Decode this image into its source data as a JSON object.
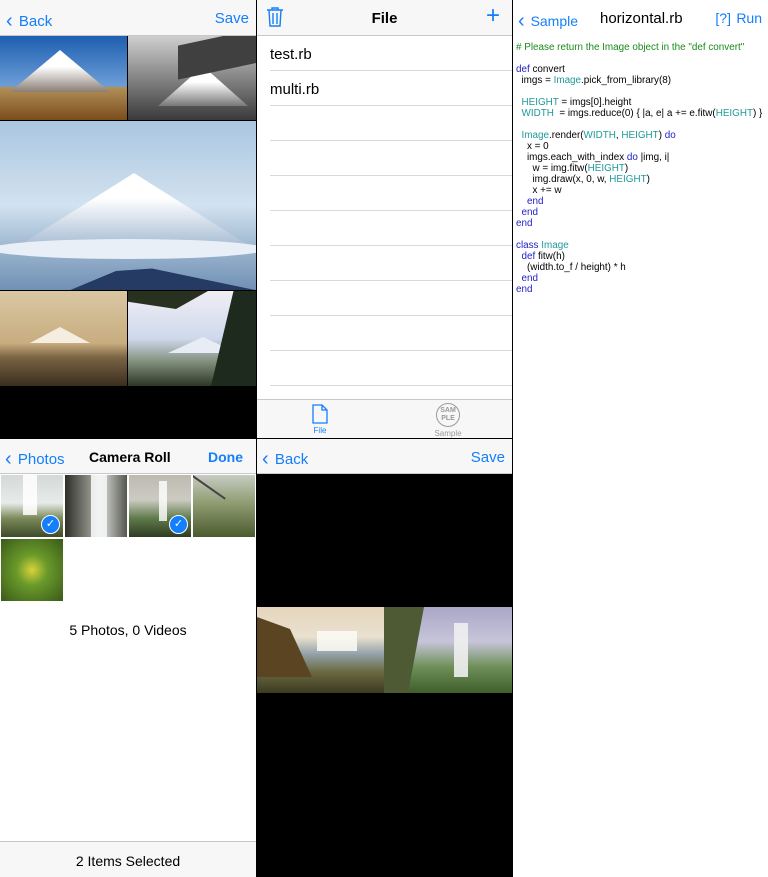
{
  "panel1": {
    "back_label": "Back",
    "save_label": "Save"
  },
  "panel2": {
    "title": "File",
    "files": [
      "test.rb",
      "multi.rb"
    ],
    "tabs": [
      {
        "label": "File",
        "icon": "file-icon"
      },
      {
        "label": "Sample",
        "icon": "sample-icon",
        "badge": "SAM\nPLE"
      }
    ]
  },
  "panel3": {
    "back_label": "Sample",
    "title": "horizontal.rb",
    "help_label": "[?]",
    "run_label": "Run",
    "code": [
      [
        [
          "# Please return the Image object in the \"def convert\"",
          "com"
        ]
      ],
      [
        [
          "",
          "txt"
        ]
      ],
      [
        [
          "def",
          "kw"
        ],
        [
          " convert",
          "txt"
        ]
      ],
      [
        [
          "  imgs = ",
          "txt"
        ],
        [
          "Image",
          "cl"
        ],
        [
          ".pick_from_library(8)",
          "txt"
        ]
      ],
      [
        [
          "",
          "txt"
        ]
      ],
      [
        [
          "  ",
          "txt"
        ],
        [
          "HEIGHT",
          "cl"
        ],
        [
          " = imgs[0].height",
          "txt"
        ]
      ],
      [
        [
          "  ",
          "txt"
        ],
        [
          "WIDTH",
          "cl"
        ],
        [
          "  = imgs.reduce(0) { |a, e| a += e.fitw(",
          "txt"
        ],
        [
          "HEIGHT",
          "cl"
        ],
        [
          ") }",
          "txt"
        ]
      ],
      [
        [
          "",
          "txt"
        ]
      ],
      [
        [
          "  ",
          "txt"
        ],
        [
          "Image",
          "cl"
        ],
        [
          ".render(",
          "txt"
        ],
        [
          "WIDTH",
          "cl"
        ],
        [
          ", ",
          "txt"
        ],
        [
          "HEIGHT",
          "cl"
        ],
        [
          ") ",
          "txt"
        ],
        [
          "do",
          "kw"
        ]
      ],
      [
        [
          "    x = 0",
          "txt"
        ]
      ],
      [
        [
          "    imgs.each_with_index ",
          "txt"
        ],
        [
          "do",
          "kw"
        ],
        [
          " |img, i|",
          "txt"
        ]
      ],
      [
        [
          "      w = img.fitw(",
          "txt"
        ],
        [
          "HEIGHT",
          "cl"
        ],
        [
          ")",
          "txt"
        ]
      ],
      [
        [
          "      img.draw(x, 0, w, ",
          "txt"
        ],
        [
          "HEIGHT",
          "cl"
        ],
        [
          ")",
          "txt"
        ]
      ],
      [
        [
          "      x += w",
          "txt"
        ]
      ],
      [
        [
          "    ",
          "txt"
        ],
        [
          "end",
          "kw"
        ]
      ],
      [
        [
          "  ",
          "txt"
        ],
        [
          "end",
          "kw"
        ]
      ],
      [
        [
          "end",
          "kw"
        ]
      ],
      [
        [
          "",
          "txt"
        ]
      ],
      [
        [
          "class",
          "kw"
        ],
        [
          " ",
          "txt"
        ],
        [
          "Image",
          "cl"
        ]
      ],
      [
        [
          "  ",
          "txt"
        ],
        [
          "def",
          "kw"
        ],
        [
          " fitw(h)",
          "txt"
        ]
      ],
      [
        [
          "    (width.to_f / height) * h",
          "txt"
        ]
      ],
      [
        [
          "  ",
          "txt"
        ],
        [
          "end",
          "kw"
        ]
      ],
      [
        [
          "end",
          "kw"
        ]
      ]
    ]
  },
  "panel4": {
    "back_label": "Photos",
    "title": "Camera Roll",
    "done_label": "Done",
    "summary": "5 Photos, 0 Videos",
    "footer": "2 Items Selected",
    "thumbs": [
      {
        "selected": true
      },
      {
        "selected": false
      },
      {
        "selected": true
      },
      {
        "selected": false
      },
      {
        "selected": false
      }
    ]
  },
  "panel5": {
    "back_label": "Back",
    "save_label": "Save"
  },
  "colors": {
    "accent": "#147efb",
    "comment": "#1a8a1a",
    "keyword": "#2020c8",
    "class": "#1e9a9a"
  }
}
